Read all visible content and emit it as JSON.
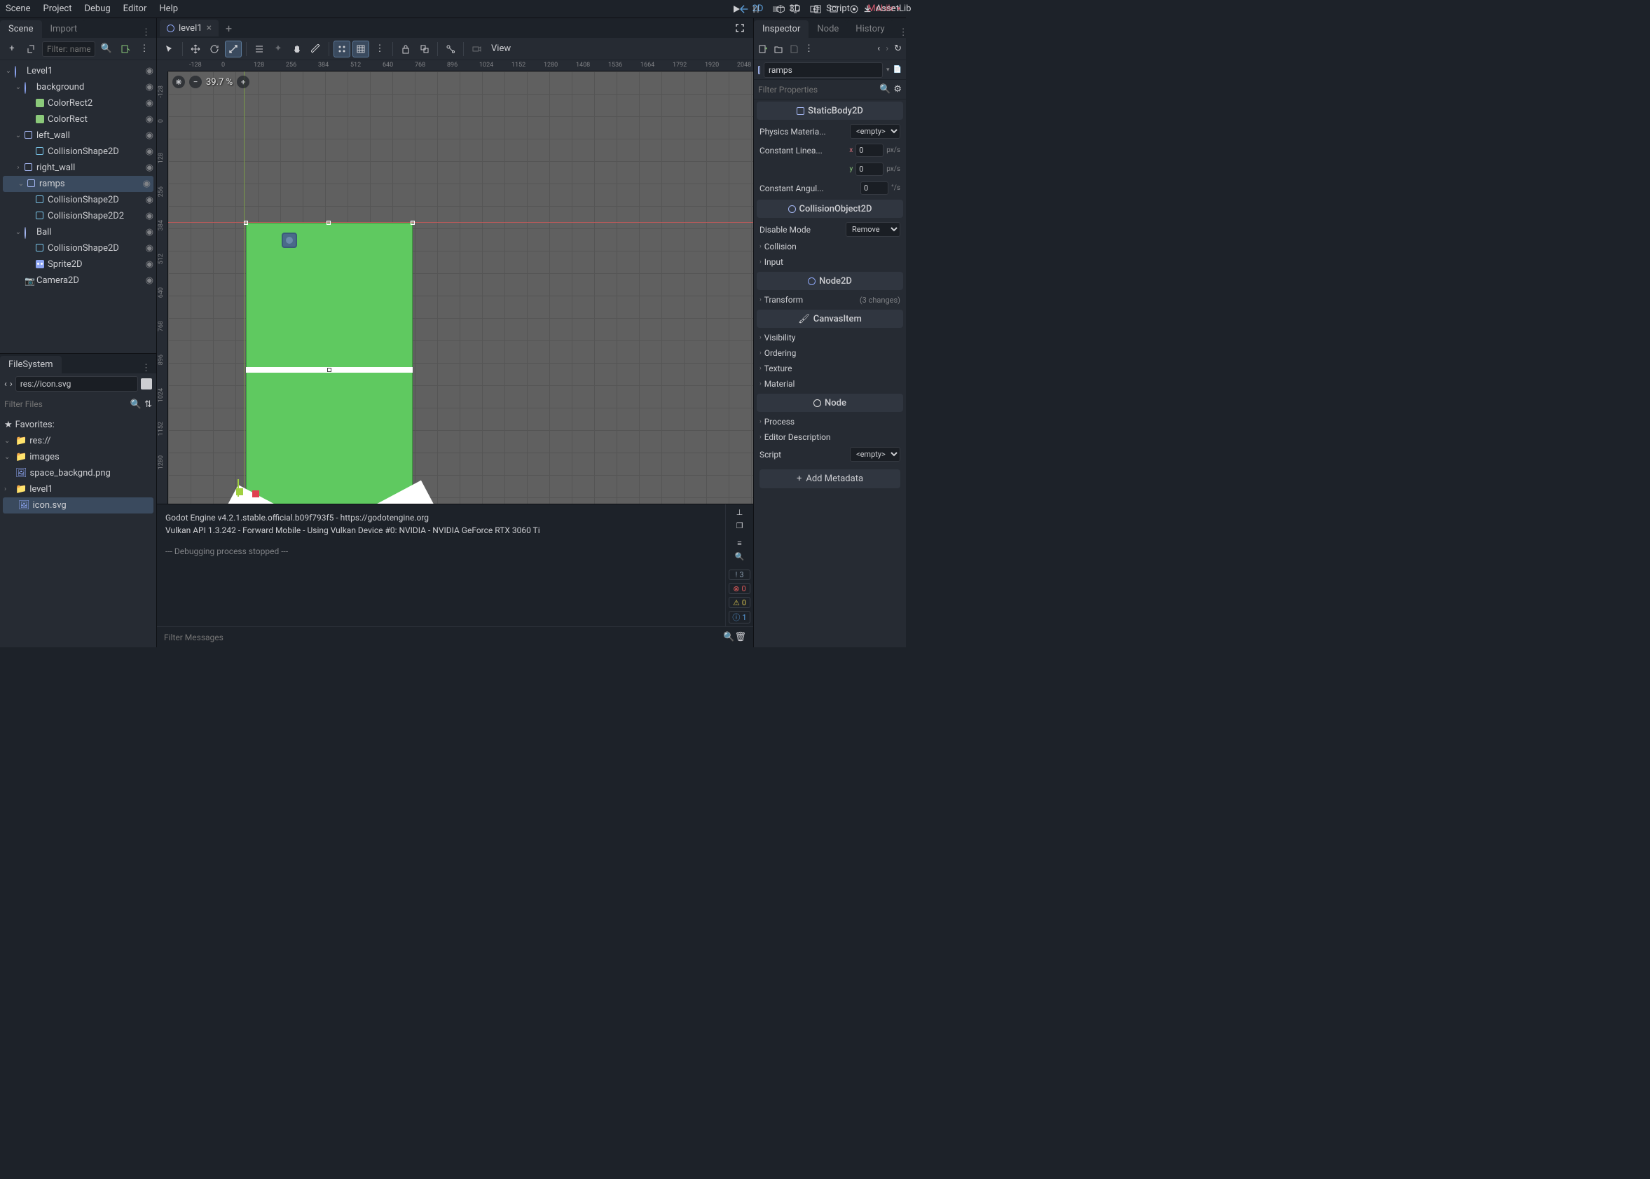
{
  "menubar": {
    "scene": "Scene",
    "project": "Project",
    "debug": "Debug",
    "editor": "Editor",
    "help": "Help"
  },
  "workspace": {
    "two_d": "2D",
    "three_d": "3D",
    "script": "Script",
    "assetlib": "AssetLib"
  },
  "topright": {
    "renderer": "Mobile"
  },
  "scene_dock": {
    "tab_scene": "Scene",
    "tab_import": "Import",
    "filter_placeholder": "Filter: name, t:type",
    "nodes": [
      {
        "name": "Level1",
        "indent": 0,
        "expanded": true,
        "selected": false,
        "icon": "node2d"
      },
      {
        "name": "background",
        "indent": 1,
        "expanded": true,
        "selected": false,
        "icon": "node2d"
      },
      {
        "name": "ColorRect2",
        "indent": 2,
        "expanded": false,
        "selected": false,
        "icon": "colorrect",
        "leaf": true
      },
      {
        "name": "ColorRect",
        "indent": 2,
        "expanded": false,
        "selected": false,
        "icon": "colorrect",
        "leaf": true
      },
      {
        "name": "left_wall",
        "indent": 1,
        "expanded": true,
        "selected": false,
        "icon": "staticbody"
      },
      {
        "name": "CollisionShape2D",
        "indent": 2,
        "expanded": false,
        "selected": false,
        "icon": "collision",
        "leaf": true
      },
      {
        "name": "right_wall",
        "indent": 1,
        "expanded": false,
        "selected": false,
        "icon": "staticbody"
      },
      {
        "name": "ramps",
        "indent": 1,
        "expanded": true,
        "selected": true,
        "icon": "staticbody"
      },
      {
        "name": "CollisionShape2D",
        "indent": 2,
        "expanded": false,
        "selected": false,
        "icon": "collision",
        "leaf": true
      },
      {
        "name": "CollisionShape2D2",
        "indent": 2,
        "expanded": false,
        "selected": false,
        "icon": "collision",
        "leaf": true
      },
      {
        "name": "Ball",
        "indent": 1,
        "expanded": true,
        "selected": false,
        "icon": "rigidbody"
      },
      {
        "name": "CollisionShape2D",
        "indent": 2,
        "expanded": false,
        "selected": false,
        "icon": "collision",
        "leaf": true
      },
      {
        "name": "Sprite2D",
        "indent": 2,
        "expanded": false,
        "selected": false,
        "icon": "sprite",
        "leaf": true
      },
      {
        "name": "Camera2D",
        "indent": 1,
        "expanded": false,
        "selected": false,
        "icon": "camera",
        "leaf": true
      }
    ]
  },
  "filesystem": {
    "title": "FileSystem",
    "path": "res://icon.svg",
    "filter_placeholder": "Filter Files",
    "favorites": "Favorites:",
    "items": [
      {
        "name": "res://",
        "indent": 0,
        "expanded": true,
        "icon": "folder"
      },
      {
        "name": "images",
        "indent": 1,
        "expanded": true,
        "icon": "folder"
      },
      {
        "name": "space_backgnd.png",
        "indent": 2,
        "icon": "image",
        "leaf": true
      },
      {
        "name": "level1",
        "indent": 1,
        "expanded": false,
        "icon": "folder"
      },
      {
        "name": "icon.svg",
        "indent": 1,
        "icon": "image",
        "leaf": true,
        "selected": true
      }
    ]
  },
  "doc_tabs": {
    "level1": "level1"
  },
  "viewport": {
    "zoom": "39.7 %",
    "view_label": "View",
    "ruler_h": [
      "-128",
      "0",
      "128",
      "256",
      "384",
      "512",
      "640",
      "768",
      "896",
      "1024",
      "1152",
      "1280",
      "1408",
      "1536",
      "1664",
      "1792",
      "1920",
      "2048"
    ],
    "ruler_v": [
      "-128",
      "0",
      "128",
      "256",
      "384",
      "512",
      "640",
      "768",
      "896",
      "1024",
      "1152",
      "1280"
    ]
  },
  "output": {
    "line1": "Godot Engine v4.2.1.stable.official.b09f793f5 - https://godotengine.org",
    "line2": "Vulkan API 1.3.242 - Forward Mobile - Using Vulkan Device #0: NVIDIA - NVIDIA GeForce RTX 3060 Ti",
    "line3": "--- Debugging process stopped ---",
    "filter_placeholder": "Filter Messages",
    "count_err": "3",
    "count_r": "0",
    "count_y": "0",
    "count_b": "1"
  },
  "inspector": {
    "tab_inspector": "Inspector",
    "tab_node": "Node",
    "tab_history": "History",
    "node_name": "ramps",
    "filter_placeholder": "Filter Properties",
    "sections": {
      "staticbody": "StaticBody2D",
      "collisionobject": "CollisionObject2D",
      "node2d": "Node2D",
      "canvasitem": "CanvasItem",
      "node": "Node"
    },
    "props": {
      "physics_material": "Physics Materia...",
      "physics_material_val": "<empty>",
      "constant_linear": "Constant Linea...",
      "cl_x": "0",
      "cl_y": "0",
      "unit_pxs": "px/s",
      "constant_angular": "Constant Angul...",
      "ca_val": "0",
      "unit_degs": "°/s",
      "disable_mode": "Disable Mode",
      "disable_mode_val": "Remove",
      "collision": "Collision",
      "input": "Input",
      "transform": "Transform",
      "transform_changes": "(3 changes)",
      "visibility": "Visibility",
      "ordering": "Ordering",
      "texture": "Texture",
      "material": "Material",
      "process": "Process",
      "editor_desc": "Editor Description",
      "script": "Script",
      "script_val": "<empty>",
      "add_metadata": "Add Metadata"
    }
  }
}
